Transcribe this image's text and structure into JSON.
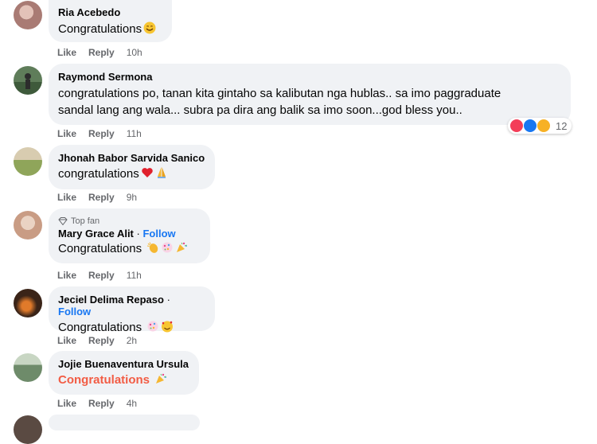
{
  "comments": [
    {
      "author": "Ria Acebedo",
      "text": "Congratulations",
      "emojis": [
        "smiling-face"
      ],
      "actions": {
        "like": "Like",
        "reply": "Reply",
        "time": "10h"
      },
      "avatar_color": "#c9a7a0"
    },
    {
      "author": "Raymond Sermona",
      "text_line1": "congratulations po, tanan kita gintaho sa kalibutan nga hublas.. sa imo paggraduate",
      "text_line2": "sandal lang ang wala... subra pa dira ang balik sa imo soon...god bless you..",
      "actions": {
        "like": "Like",
        "reply": "Reply",
        "time": "11h"
      },
      "reactions_count": "12",
      "avatar_color": "#4d6b4a"
    },
    {
      "author": "Jhonah Babor Sarvida Sanico",
      "text": "congratulations",
      "emojis": [
        "red-heart",
        "folded-hands"
      ],
      "actions": {
        "like": "Like",
        "reply": "Reply",
        "time": "9h"
      },
      "avatar_color": "#b9a86b"
    },
    {
      "badge": "Top fan",
      "author": "Mary Grace Alit",
      "separator": " · ",
      "follow": "Follow",
      "text": "Congratulations",
      "emojis": [
        "clapping-hands",
        "confetti-ball",
        "party-popper"
      ],
      "actions": {
        "like": "Like",
        "reply": "Reply",
        "time": "11h"
      },
      "avatar_color": "#d7b8a6"
    },
    {
      "author": "Jeciel Delima Repaso",
      "separator": " · ",
      "follow": "Follow",
      "text": "Congratulations",
      "emojis": [
        "confetti-ball",
        "smiling-hearts"
      ],
      "actions": {
        "like": "Like",
        "reply": "Reply",
        "time": "2h"
      },
      "avatar_color": "#7a4a2a"
    },
    {
      "author": "Jojie Buenaventura Ursula",
      "text": "Congratulations",
      "emojis": [
        "party-popper"
      ],
      "actions": {
        "like": "Like",
        "reply": "Reply",
        "time": "4h"
      },
      "avatar_color": "#8aa28a"
    }
  ],
  "colors": {
    "bubble": "#f0f2f5",
    "link": "#1877f2",
    "meta": "#65676b",
    "celebration_text": "#f25c44"
  }
}
